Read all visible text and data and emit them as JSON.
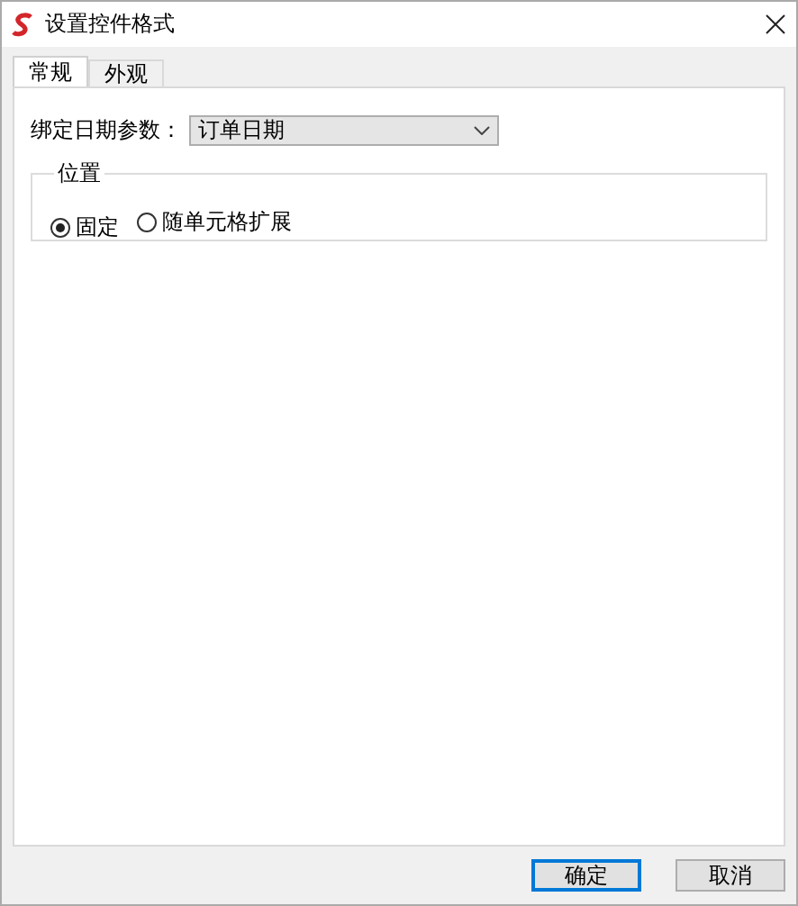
{
  "window": {
    "title": "设置控件格式"
  },
  "tabs": [
    {
      "label": "常规",
      "selected": true
    },
    {
      "label": "外观",
      "selected": false
    }
  ],
  "bind_field": {
    "label": "绑定日期参数：",
    "value": "订单日期"
  },
  "position_group": {
    "title": "位置",
    "options": [
      {
        "label": "固定",
        "selected": true
      },
      {
        "label": "随单元格扩展",
        "selected": false
      }
    ]
  },
  "buttons": [
    {
      "label": "确定",
      "kind": "default"
    },
    {
      "label": "取消",
      "kind": "normal"
    }
  ]
}
